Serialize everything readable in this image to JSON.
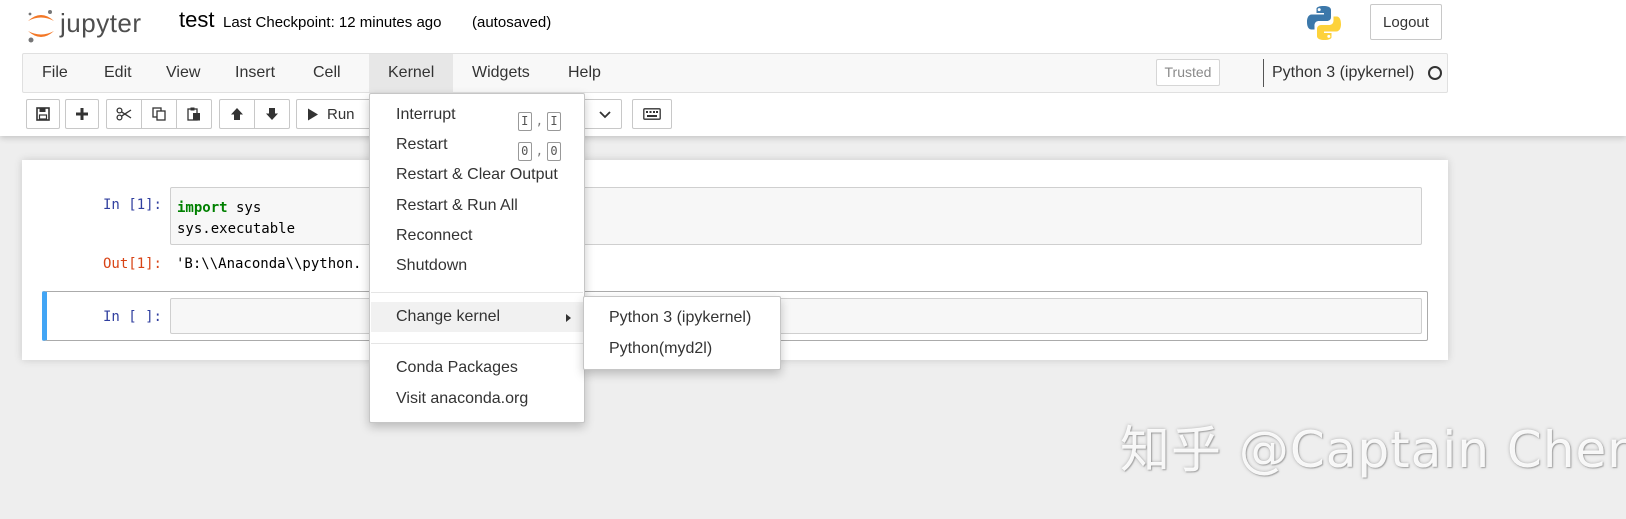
{
  "header": {
    "logo_text": "jupyter",
    "notebook_name": "test",
    "checkpoint_text": "Last Checkpoint: 12 minutes ago",
    "autosave_text": "(autosaved)",
    "logout_label": "Logout"
  },
  "menubar": {
    "items": [
      {
        "label": "File"
      },
      {
        "label": "Edit"
      },
      {
        "label": "View"
      },
      {
        "label": "Insert"
      },
      {
        "label": "Cell"
      },
      {
        "label": "Kernel"
      },
      {
        "label": "Widgets"
      },
      {
        "label": "Help"
      }
    ],
    "active": "Kernel",
    "trusted_label": "Trusted",
    "kernel_name": "Python 3 (ipykernel)"
  },
  "toolbar": {
    "run_label": "Run"
  },
  "cells": [
    {
      "in_prompt": "In [1]:",
      "code_keyword": "import",
      "code_line1_rest": " sys",
      "code_line2": "sys.executable",
      "out_prompt": "Out[1]:",
      "output": "'B:\\\\Anaconda\\\\python."
    },
    {
      "in_prompt": "In [ ]:"
    }
  ],
  "kernel_menu": {
    "items": [
      {
        "label": "Interrupt",
        "shortcut": [
          "I",
          "I"
        ]
      },
      {
        "label": "Restart",
        "shortcut": [
          "0",
          "0"
        ]
      },
      {
        "label": "Restart & Clear Output"
      },
      {
        "label": "Restart & Run All"
      },
      {
        "label": "Reconnect"
      },
      {
        "label": "Shutdown"
      },
      {
        "label": "Change kernel"
      },
      {
        "label": "Conda Packages"
      },
      {
        "label": "Visit anaconda.org"
      }
    ],
    "submenu": [
      {
        "label": "Python 3 (ipykernel)"
      },
      {
        "label": "Python(myd2l)"
      }
    ]
  },
  "watermark": "知乎 @Captain Chen",
  "colors": {
    "accent_blue": "#42a5f5",
    "jupyter_orange": "#f37726",
    "keyword_green": "#008000",
    "in_prompt": "#303f9f",
    "out_prompt": "#d84315"
  }
}
